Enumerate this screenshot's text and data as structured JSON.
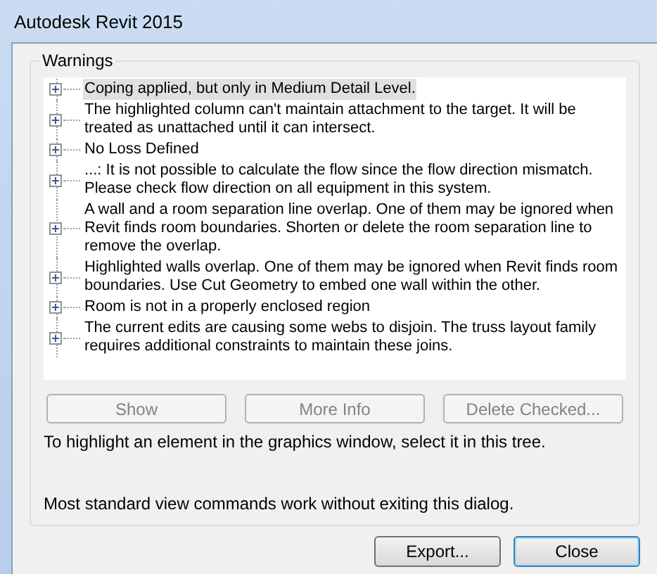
{
  "window": {
    "title": "Autodesk Revit 2015"
  },
  "warnings": {
    "label": "Warnings",
    "items": [
      {
        "text": "Coping applied, but only in Medium Detail Level.",
        "selected": true,
        "expanded": false
      },
      {
        "text": "The highlighted column can't maintain attachment to the target.  It will be treated as unattached until it can intersect.",
        "selected": false,
        "expanded": false
      },
      {
        "text": "No Loss Defined",
        "selected": false,
        "expanded": false
      },
      {
        "text": "...: It is not possible to calculate the flow since the flow direction mismatch. Please check flow direction on all equipment in this system.",
        "selected": false,
        "expanded": false
      },
      {
        "text": "A wall and a room separation line overlap. One of them may be ignored when Revit finds room boundaries. Shorten or delete the room separation line to remove the overlap.",
        "selected": false,
        "expanded": false
      },
      {
        "text": "Highlighted walls overlap. One of them may be ignored when Revit finds room boundaries. Use Cut Geometry to embed one wall within the other.",
        "selected": false,
        "expanded": false
      },
      {
        "text": "Room is not in a properly enclosed region",
        "selected": false,
        "expanded": false
      },
      {
        "text": "The current edits are causing some webs to disjoin.  The truss layout family requires additional constraints to maintain these joins.",
        "selected": false,
        "expanded": false
      }
    ]
  },
  "actions": [
    {
      "label": "Show",
      "disabled": true
    },
    {
      "label": "More Info",
      "disabled": true
    },
    {
      "label": "Delete Checked...",
      "disabled": true
    }
  ],
  "hints": [
    "To highlight an element in the graphics window, select it in this tree.",
    "Most standard view commands work without exiting this dialog."
  ],
  "buttons": [
    {
      "label": "Export...",
      "default": false
    },
    {
      "label": "Close",
      "default": true
    }
  ]
}
